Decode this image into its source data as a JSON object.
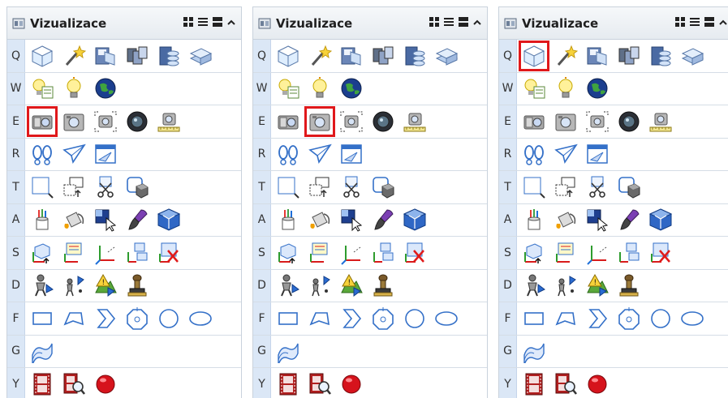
{
  "panels": [
    {
      "title": "Vizualizace"
    },
    {
      "title": "Vizualizace"
    },
    {
      "title": "Vizualizace"
    }
  ],
  "rows": [
    {
      "key": "Q",
      "icons": [
        "box-shaded-icon",
        "magic-wand-icon",
        "save-view-icon",
        "multi-view-icon",
        "save-layers-icon",
        "stack-icon"
      ]
    },
    {
      "key": "W",
      "icons": [
        "light-list-icon",
        "light-bulb-icon",
        "globe-icon"
      ]
    },
    {
      "key": "E",
      "icons": [
        "camera-icon",
        "camera-frame-icon",
        "camera-target-icon",
        "camera-lens-icon",
        "camera-measure-icon"
      ]
    },
    {
      "key": "R",
      "icons": [
        "footsteps-icon",
        "paper-plane-icon",
        "window-plane-icon"
      ]
    },
    {
      "key": "T",
      "icons": [
        "clip-box-icon",
        "clip-arrow-icon",
        "clip-cut-icon",
        "clip-cube-icon"
      ]
    },
    {
      "key": "A",
      "icons": [
        "paint-bucket-color-icon",
        "paint-bucket-icon",
        "paint-select-icon",
        "paint-brush-icon",
        "cube-render-icon"
      ]
    },
    {
      "key": "S",
      "icons": [
        "axis-box-icon",
        "axis-list-icon",
        "axis-plain-icon",
        "axis-duplicate-icon",
        "axis-delete-icon"
      ]
    },
    {
      "key": "D",
      "icons": [
        "person-walk-icon",
        "person-point-icon",
        "terrain-warning-icon",
        "stamp-icon"
      ]
    },
    {
      "key": "F",
      "icons": [
        "rectangle-shape-icon",
        "polygon-shape-icon",
        "chevron-shape-icon",
        "octagon-shape-icon",
        "circle-shape-icon",
        "ellipse-shape-icon"
      ]
    },
    {
      "key": "G",
      "icons": [
        "surface-icon"
      ]
    },
    {
      "key": "Y",
      "icons": [
        "film-strip-icon",
        "film-search-icon",
        "record-icon"
      ]
    }
  ],
  "selection": [
    {
      "row": 2,
      "icon": 0
    },
    {
      "row": 2,
      "icon": 1
    },
    {
      "row": 0,
      "icon": 0
    }
  ],
  "colors": {
    "selection": "#e0181b",
    "key_column": "#dbe7f6",
    "header": "#e6ebf0"
  }
}
